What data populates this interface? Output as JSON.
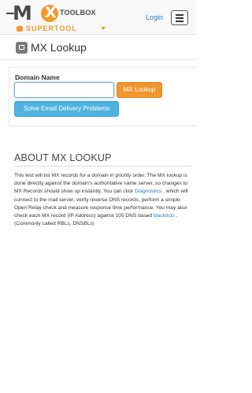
{
  "brand": {
    "logo_text": "MX TOOLBOX",
    "logo_mx": "M",
    "logo_x": "X",
    "logo_toolbox": "TOOLBOX",
    "supertool_label": "SUPERTOOL",
    "accent_color": "#f29a2e"
  },
  "nav": {
    "login_label": "Login",
    "menu_icon": "hamburger-menu-icon"
  },
  "lookup": {
    "title": "MX Lookup",
    "icon": "envelope-icon",
    "field_label": "Domain Name",
    "domain_value": "",
    "placeholder": "",
    "submit_label": "MX Lookup",
    "solve_label": "Solve Email Delivery Problems"
  },
  "about": {
    "title": "ABOUT MX LOOKUP",
    "text_1": "This test will list MX records for a domain in priority order. The MX lookup is done directly against the domain's authoritative name server, so changes to MX Records should show up instantly. You can click ",
    "link_diagnostics": "Diagnostics",
    "text_2": " , which will connect to the mail server, verify reverse DNS records, perform a simple Open Relay check and measure response time performance. You may also check each MX record (IP Address) against 105 DNS based ",
    "link_blacklists": "blacklists",
    "text_3": " . (Commonly called RBLs, DNSBLs)"
  }
}
